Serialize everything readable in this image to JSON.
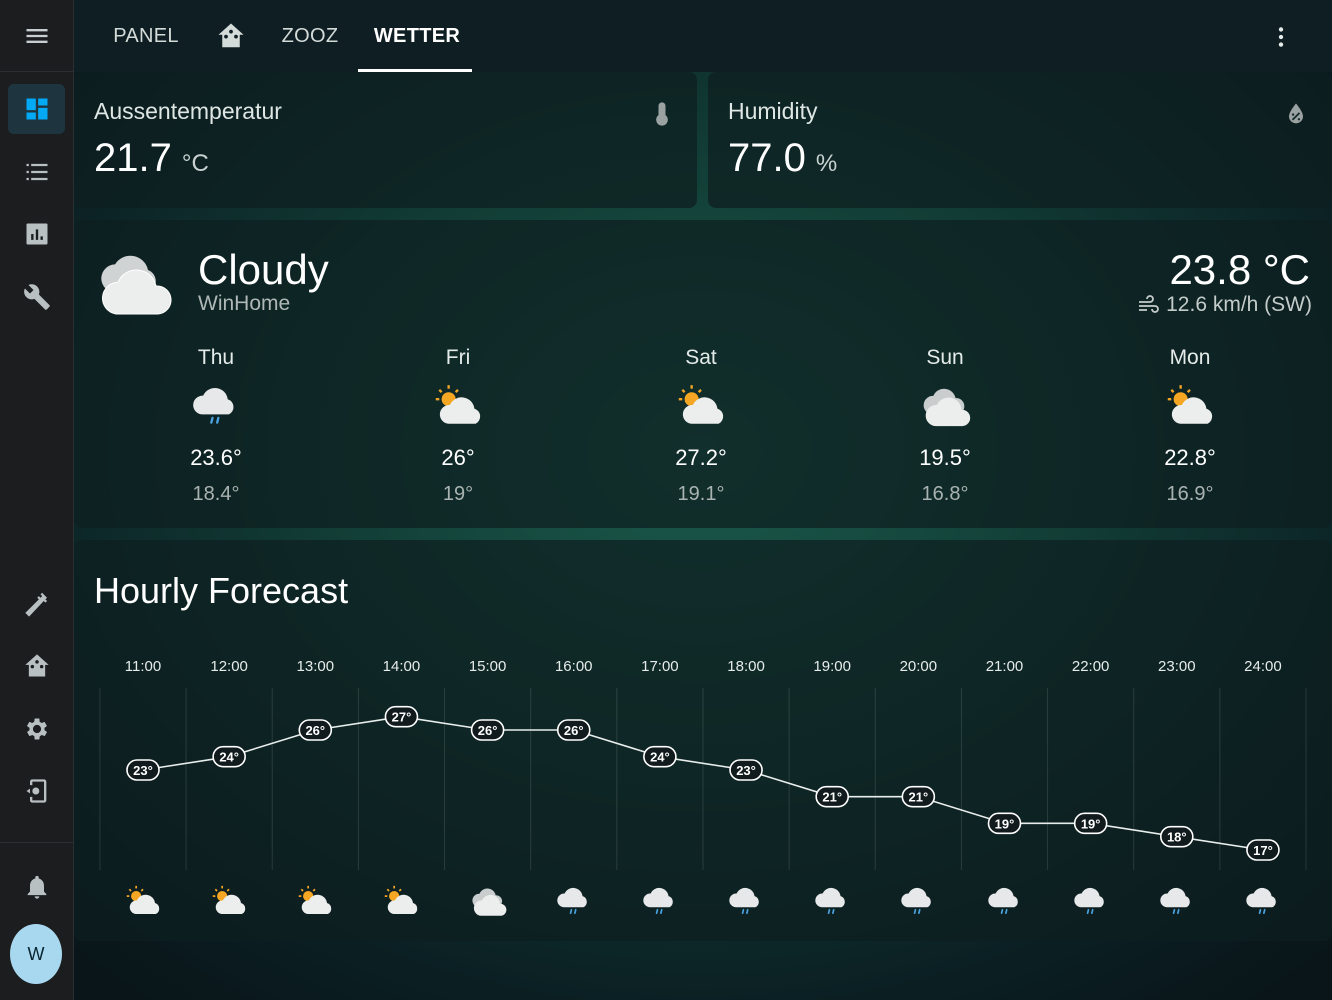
{
  "topbar": {
    "tabs": [
      {
        "label": "PANEL"
      },
      {
        "label": ""
      },
      {
        "label": "ZOOZ"
      },
      {
        "label": "WETTER"
      }
    ],
    "active_tab": "WETTER"
  },
  "sidebar": {
    "items": [
      "dashboard-icon",
      "logbook-icon",
      "history-icon",
      "wrench-icon",
      "hammer-icon",
      "home-assistant-icon",
      "gear-icon",
      "developer-tools-icon",
      "bell-icon"
    ],
    "avatar_initial": "W"
  },
  "sensors": [
    {
      "name": "Aussentemperatur",
      "value": "21.7",
      "unit": "°C",
      "icon": "thermometer-icon"
    },
    {
      "name": "Humidity",
      "value": "77.0",
      "unit": "%",
      "icon": "water-percent-icon"
    }
  ],
  "weather": {
    "condition": "Cloudy",
    "location": "WinHome",
    "temperature": "23.8 °C",
    "wind": "12.6 km/h (SW)",
    "forecast": [
      {
        "day": "Thu",
        "icon": "rainy",
        "high": "23.6°",
        "low": "18.4°"
      },
      {
        "day": "Fri",
        "icon": "partly-cloudy",
        "high": "26°",
        "low": "19°"
      },
      {
        "day": "Sat",
        "icon": "partly-cloudy",
        "high": "27.2°",
        "low": "19.1°"
      },
      {
        "day": "Sun",
        "icon": "cloudy",
        "high": "19.5°",
        "low": "16.8°"
      },
      {
        "day": "Mon",
        "icon": "partly-cloudy",
        "high": "22.8°",
        "low": "16.9°"
      }
    ]
  },
  "hourly": {
    "title": "Hourly Forecast"
  },
  "chart_data": {
    "type": "line",
    "x": [
      "11:00",
      "12:00",
      "13:00",
      "14:00",
      "15:00",
      "16:00",
      "17:00",
      "18:00",
      "19:00",
      "20:00",
      "21:00",
      "22:00",
      "23:00",
      "24:00"
    ],
    "series": [
      {
        "values": [
          23,
          24,
          26,
          27,
          26,
          26,
          24,
          23,
          21,
          21,
          19,
          19,
          18,
          17
        ]
      }
    ],
    "data_labels": [
      "23°",
      "24°",
      "26°",
      "27°",
      "26°",
      "26°",
      "24°",
      "23°",
      "21°",
      "21°",
      "19°",
      "19°",
      "18°",
      "17°"
    ],
    "conditions": [
      "partly-cloudy",
      "partly-cloudy",
      "partly-cloudy",
      "partly-cloudy",
      "cloudy",
      "rainy",
      "rainy",
      "rainy",
      "rainy",
      "rainy",
      "rainy",
      "rainy",
      "rainy",
      "rainy"
    ],
    "title": "Hourly Forecast",
    "ylim": [
      15.5,
      29
    ],
    "grid": true
  },
  "colors": {
    "accent": "#03a9f4",
    "sun": "#f5a623",
    "cloud": "#e6e6e6",
    "rain": "#4aa3df"
  }
}
